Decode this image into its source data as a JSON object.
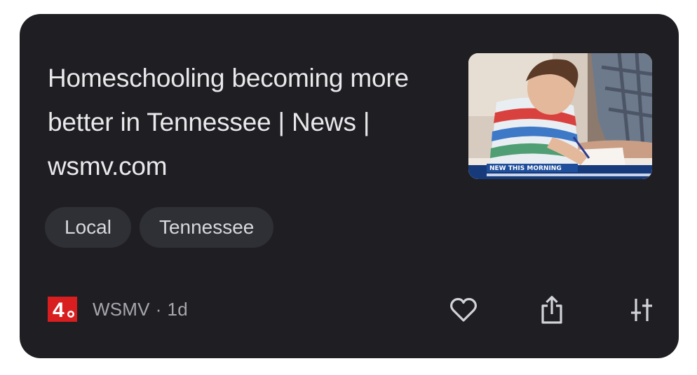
{
  "card": {
    "headline": "Homeschooling becoming more better in Tennessee | News | wsmv.com",
    "thumbnail": {
      "caption": "NEW THIS MORNING",
      "icon": "news-photo"
    },
    "tags": [
      {
        "label": "Local"
      },
      {
        "label": "Tennessee"
      }
    ],
    "source": {
      "name": "WSMV",
      "separator": "·",
      "age": "1d",
      "logo_text": "4",
      "logo_color": "#d81e1e"
    },
    "actions": [
      {
        "name": "like",
        "icon": "heart-icon"
      },
      {
        "name": "share",
        "icon": "share-icon"
      },
      {
        "name": "options",
        "icon": "sort-icon"
      }
    ]
  },
  "colors": {
    "card_background": "#1f1f23",
    "headline_text": "#e9e9ec",
    "chip_background": "#2f3036",
    "chip_text": "#d7d8dc",
    "muted_text": "#a6a7ad",
    "icon_color": "#d2d3d8",
    "caption_bar": "#1f4f9c"
  }
}
